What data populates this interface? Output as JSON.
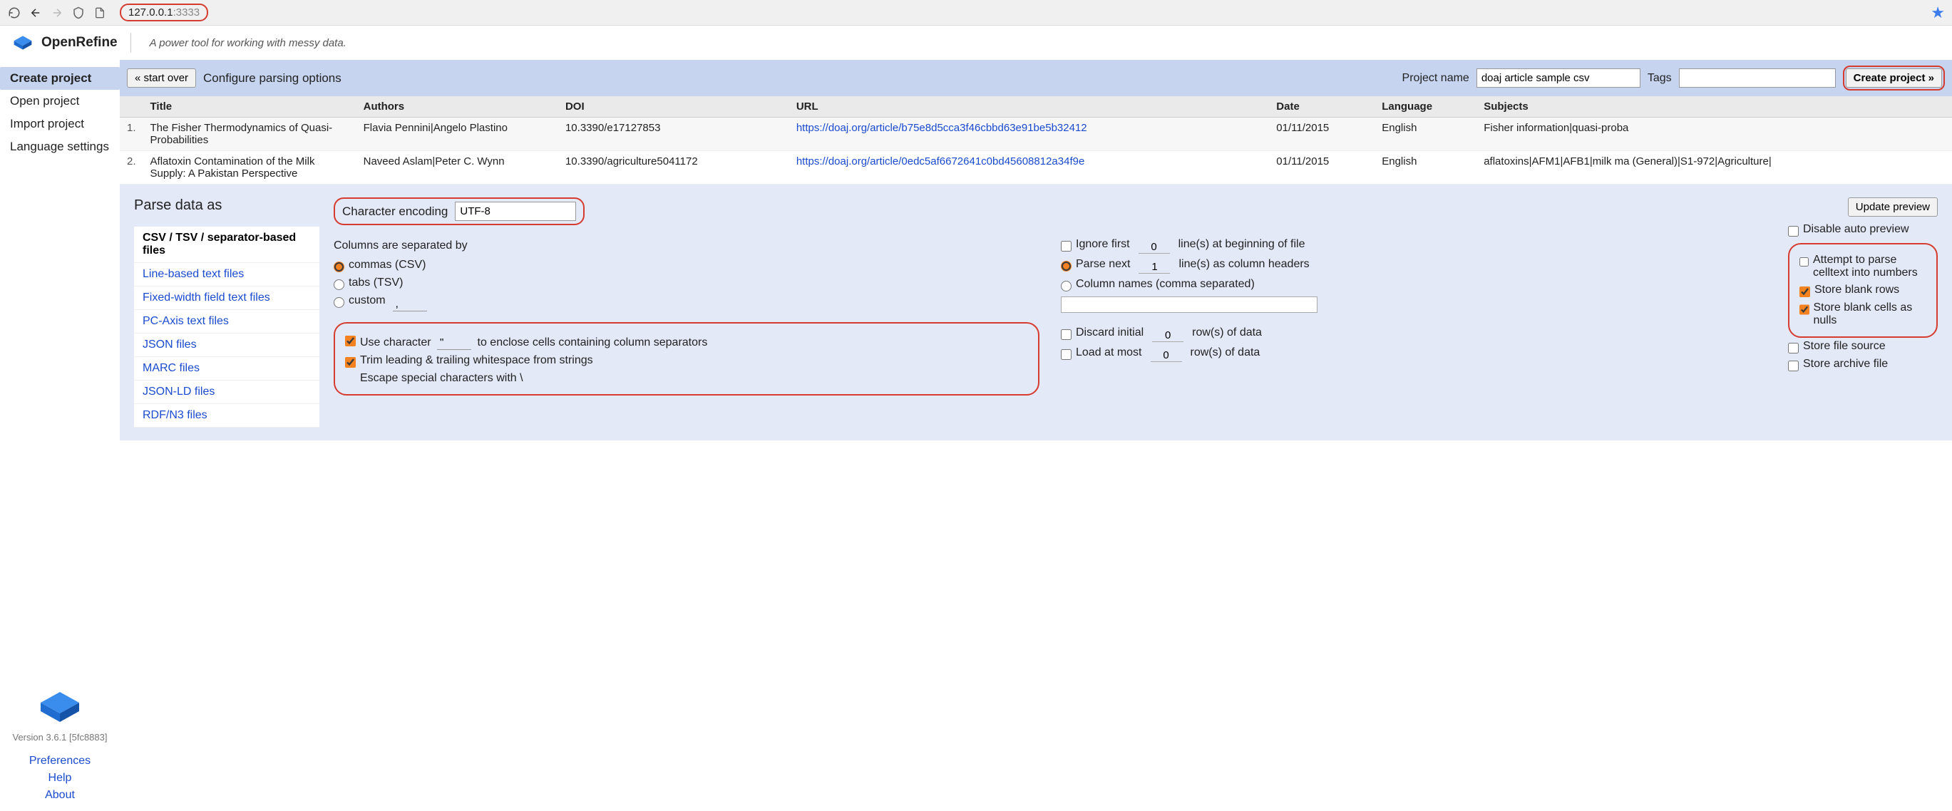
{
  "browser": {
    "url_host": "127.0.0.1",
    "url_port": ":3333"
  },
  "header": {
    "app_name": "OpenRefine",
    "tagline": "A power tool for working with messy data."
  },
  "sidebar": {
    "items": [
      {
        "label": "Create project",
        "active": true
      },
      {
        "label": "Open project",
        "active": false
      },
      {
        "label": "Import project",
        "active": false
      },
      {
        "label": "Language settings",
        "active": false
      }
    ],
    "version": "Version 3.6.1 [5fc8883]",
    "footer_links": [
      "Preferences",
      "Help",
      "About"
    ]
  },
  "action_bar": {
    "start_over": "« start over",
    "configure": "Configure parsing options",
    "project_name_label": "Project name",
    "project_name_value": "doaj article sample csv",
    "tags_label": "Tags",
    "tags_value": "",
    "create_project": "Create project »"
  },
  "table": {
    "headers": [
      "Title",
      "Authors",
      "DOI",
      "URL",
      "Date",
      "Language",
      "Subjects"
    ],
    "rows": [
      {
        "num": "1.",
        "title": "The Fisher Thermodynamics of Quasi-Probabilities",
        "authors": "Flavia Pennini|Angelo Plastino",
        "doi": "10.3390/e17127853",
        "url": "https://doaj.org/article/b75e8d5cca3f46cbbd63e91be5b32412",
        "date": "01/11/2015",
        "language": "English",
        "subjects": "Fisher information|quasi-proba"
      },
      {
        "num": "2.",
        "title": "Aflatoxin Contamination of the Milk Supply: A Pakistan Perspective",
        "authors": "Naveed Aslam|Peter C. Wynn",
        "doi": "10.3390/agriculture5041172",
        "url": "https://doaj.org/article/0edc5af6672641c0bd45608812a34f9e",
        "date": "01/11/2015",
        "language": "English",
        "subjects": "aflatoxins|AFM1|AFB1|milk ma (General)|S1-972|Agriculture|"
      }
    ]
  },
  "parse": {
    "heading": "Parse data as",
    "formats": [
      {
        "label": "CSV / TSV / separator-based files",
        "active": true
      },
      {
        "label": "Line-based text files"
      },
      {
        "label": "Fixed-width field text files"
      },
      {
        "label": "PC-Axis text files"
      },
      {
        "label": "JSON files"
      },
      {
        "label": "MARC files"
      },
      {
        "label": "JSON-LD files"
      },
      {
        "label": "RDF/N3 files"
      }
    ],
    "encoding_label": "Character encoding",
    "encoding_value": "UTF-8",
    "update_preview": "Update preview",
    "disable_auto_preview": "Disable auto preview",
    "cols_separated": "Columns are separated by",
    "sep_commas": "commas (CSV)",
    "sep_tabs": "tabs (TSV)",
    "sep_custom": "custom",
    "sep_custom_value": ",",
    "use_char_before": "Use character",
    "use_char_value": "\"",
    "use_char_after": "to enclose cells containing column separators",
    "trim": "Trim leading & trailing whitespace from strings",
    "escape": "Escape special characters with \\",
    "ignore_first": "Ignore first",
    "ignore_first_val": "0",
    "ignore_first_after": "line(s) at beginning of file",
    "parse_next": "Parse next",
    "parse_next_val": "1",
    "parse_next_after": "line(s) as column headers",
    "col_names": "Column names (comma separated)",
    "discard_initial": "Discard initial",
    "discard_initial_val": "0",
    "discard_after": "row(s) of data",
    "load_most": "Load at most",
    "load_most_val": "0",
    "load_most_after": "row(s) of data",
    "attempt_parse": "Attempt to parse celltext into numbers",
    "store_blank_rows": "Store blank rows",
    "store_blank_cells": "Store blank cells as nulls",
    "store_file_source": "Store file source",
    "store_archive": "Store archive file"
  }
}
